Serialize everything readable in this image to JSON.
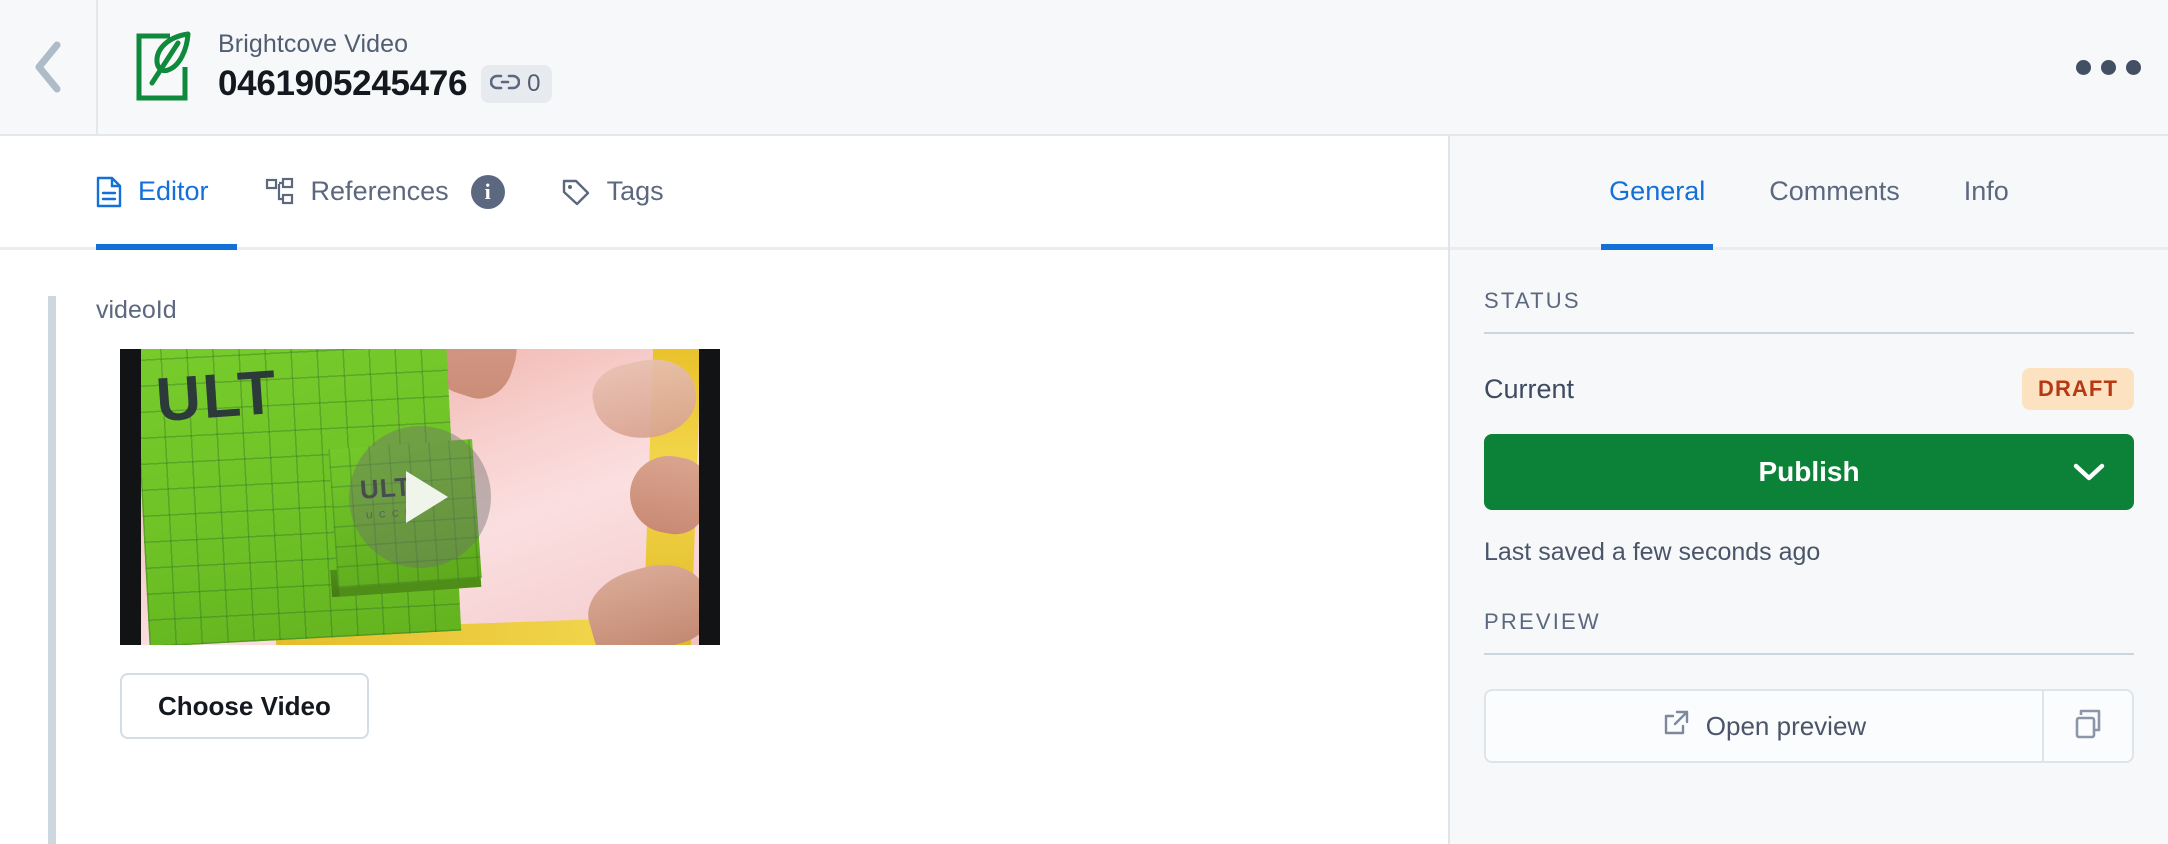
{
  "header": {
    "back_icon": "chevron-left-icon",
    "logo_icon": "document-leaf-logo",
    "doc_type": "Brightcove Video",
    "doc_id": "0461905245476",
    "link_icon": "link-icon",
    "link_count": "0",
    "menu_icon": "ellipsis-horizontal-icon"
  },
  "editor": {
    "tabs": [
      {
        "label": "Editor",
        "icon": "document-icon",
        "active": true
      },
      {
        "label": "References",
        "icon": "sitemap-icon",
        "active": false,
        "info_icon": "info-circle-icon",
        "info_glyph": "i"
      },
      {
        "label": "Tags",
        "icon": "tag-icon",
        "active": false
      }
    ],
    "field_label": "videoId",
    "video": {
      "play_icon": "play-button-icon",
      "text_large": "ULT",
      "text_small": "ULT",
      "text_tiny": "U C C I"
    },
    "choose_video_label": "Choose Video"
  },
  "inspector": {
    "tabs": [
      {
        "label": "General",
        "active": true
      },
      {
        "label": "Comments",
        "active": false
      },
      {
        "label": "Info",
        "active": false
      }
    ],
    "status": {
      "section_title": "STATUS",
      "current_label": "Current",
      "badge": "DRAFT",
      "publish_label": "Publish",
      "publish_chevron_icon": "chevron-down-icon",
      "saved_text": "Last saved a few seconds ago"
    },
    "preview": {
      "section_title": "PREVIEW",
      "open_label": "Open preview",
      "open_icon": "external-link-icon",
      "copy_icon": "copy-icon"
    }
  },
  "colors": {
    "accent_blue": "#1270d8",
    "publish_green": "#0b8238",
    "logo_green": "#0f8a3c",
    "draft_bg": "#fce2c0",
    "draft_text": "#b63913",
    "panel_bg": "#f7f8f9"
  }
}
